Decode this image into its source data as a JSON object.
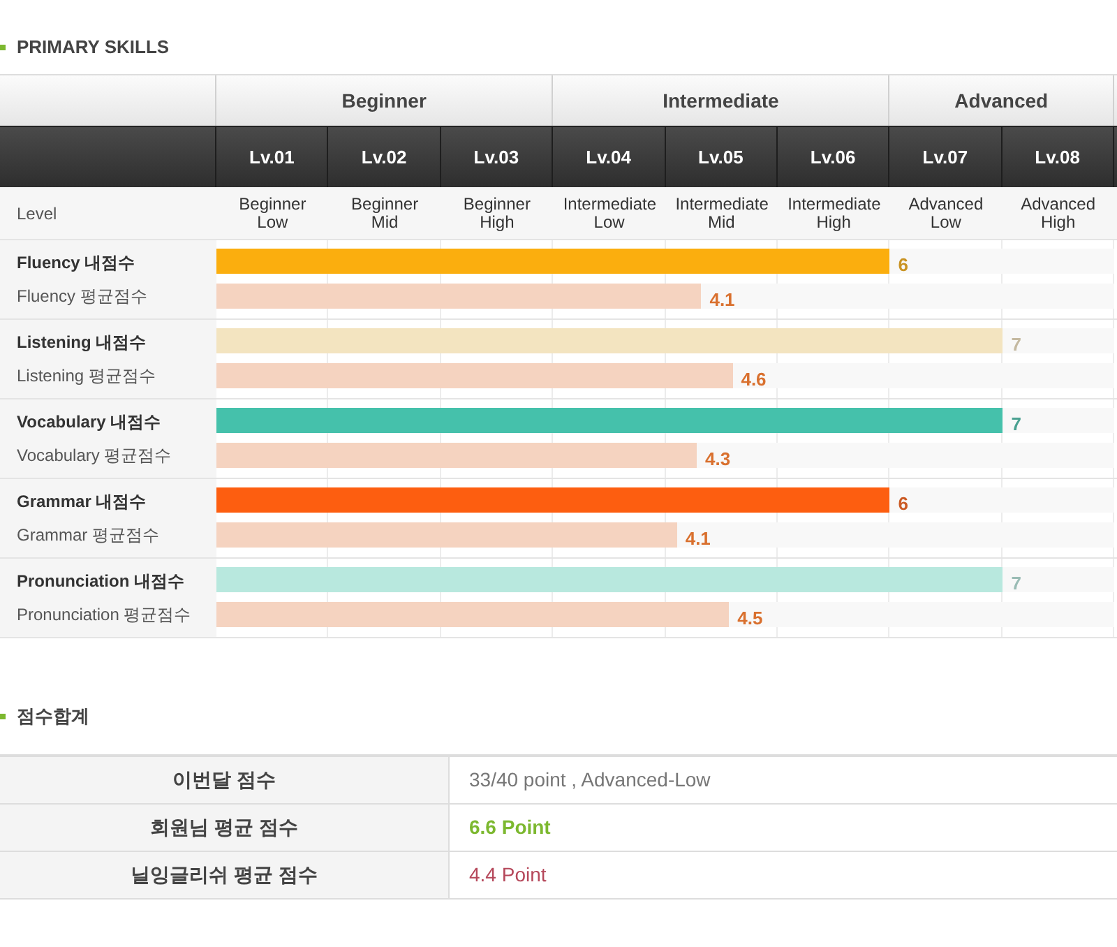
{
  "skills_title": "PRIMARY SKILLS",
  "groups": [
    {
      "label": "Beginner",
      "levels": [
        {
          "code": "Lv.01",
          "name": "Beginner Low"
        },
        {
          "code": "Lv.02",
          "name": "Beginner Mid"
        },
        {
          "code": "Lv.03",
          "name": "Beginner High"
        }
      ]
    },
    {
      "label": "Intermediate",
      "levels": [
        {
          "code": "Lv.04",
          "name": "Intermediate Low"
        },
        {
          "code": "Lv.05",
          "name": "Intermediate Mid"
        },
        {
          "code": "Lv.06",
          "name": "Intermediate High"
        }
      ]
    },
    {
      "label": "Advanced",
      "levels": [
        {
          "code": "Lv.07",
          "name": "Advanced Low"
        },
        {
          "code": "Lv.08",
          "name": "Advanced High"
        }
      ]
    }
  ],
  "level_row_label": "Level",
  "skills": [
    {
      "mine_label": "Fluency 내점수",
      "mine": {
        "level": 0.75,
        "score": "6"
      },
      "color": "#fbae0e",
      "avg_label": "Fluency 평균점수",
      "avg": {
        "level": 0.54,
        "score": "4.1"
      }
    },
    {
      "mine_label": "Listening 내점수",
      "mine": {
        "level": 0.876,
        "score": "7"
      },
      "color": "#f3e4c0",
      "avg_label": "Listening 평균점수",
      "avg": {
        "level": 0.575,
        "score": "4.6"
      }
    },
    {
      "mine_label": "Vocabulary 내점수",
      "mine": {
        "level": 0.876,
        "score": "7"
      },
      "color": "#45c1ab",
      "avg_label": "Vocabulary 평균점수",
      "avg": {
        "level": 0.535,
        "score": "4.3"
      }
    },
    {
      "mine_label": "Grammar 내점수",
      "mine": {
        "level": 0.75,
        "score": "6"
      },
      "color": "#fd5e10",
      "avg_label": "Grammar 평균점수",
      "avg": {
        "level": 0.513,
        "score": "4.1"
      }
    },
    {
      "mine_label": "Pronunciation 내점수",
      "mine": {
        "level": 0.876,
        "score": "7"
      },
      "color": "#b8e8de",
      "avg_label": "Pronunciation 평균점수",
      "avg": {
        "level": 0.571,
        "score": "4.5"
      }
    }
  ],
  "totals_title": "점수합계",
  "totals": [
    {
      "label": "이번달 점수",
      "value": "33/40 point , Advanced-Low",
      "kind": "plain"
    },
    {
      "label": "회원님 평균 점수",
      "value": "6.6 Point",
      "kind": "member"
    },
    {
      "label": "닐잉글리쉬 평균 점수",
      "value": "4.4 Point",
      "kind": "average"
    }
  ]
}
